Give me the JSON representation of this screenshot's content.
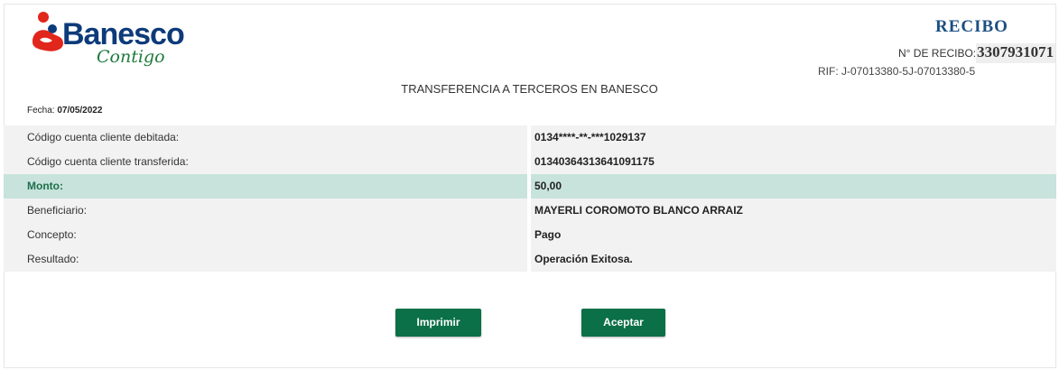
{
  "brand": {
    "name": "Banesco",
    "tagline": "Contigo",
    "colors": {
      "red": "#e1261c",
      "navy": "#0d3b7a",
      "green": "#1e7b3c"
    }
  },
  "receipt": {
    "title": "RECIBO",
    "number_label": "N° DE RECIBO:",
    "number": "3307931071",
    "rif": "RIF: J-07013380-5J-07013380-5"
  },
  "heading": "TRANSFERENCIA A TERCEROS EN BANESCO",
  "fecha": {
    "label": "Fecha: ",
    "value": "07/05/2022"
  },
  "rows": [
    {
      "label": "Código cuenta cliente debitada:",
      "value": "0134****-**-***1029137"
    },
    {
      "label": "Código cuenta cliente transferida:",
      "value": "01340364313641091175"
    },
    {
      "label": "Monto:",
      "value": "50,00"
    },
    {
      "label": "Beneficiario:",
      "value": "MAYERLI COROMOTO BLANCO ARRAIZ"
    },
    {
      "label": "Concepto:",
      "value": "Pago"
    },
    {
      "label": "Resultado:",
      "value": "Operación Exitosa."
    }
  ],
  "buttons": {
    "print": "Imprimir",
    "accept": "Aceptar"
  },
  "colors": {
    "accent": "#0b7047",
    "highlight_row": "#c7e3dc",
    "row_bg": "#f2f2f2"
  }
}
